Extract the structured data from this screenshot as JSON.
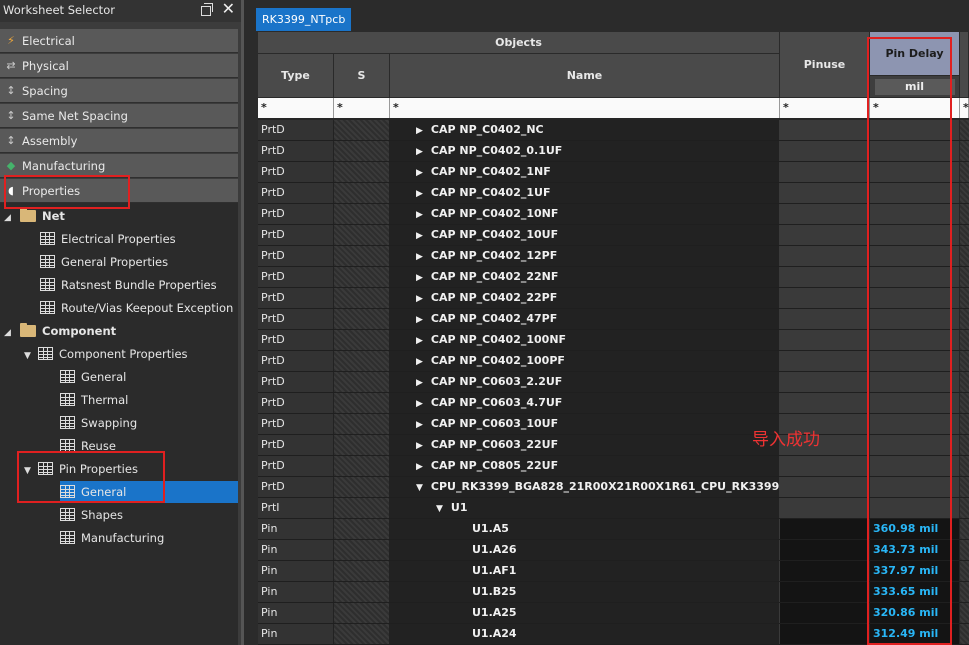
{
  "panel": {
    "title": "Worksheet Selector",
    "categories": [
      {
        "label": "Electrical",
        "icon": "lightning-icon",
        "color": "#f2a93b"
      },
      {
        "label": "Physical",
        "icon": "arrows-icon",
        "color": "#cccccc"
      },
      {
        "label": "Spacing",
        "icon": "spacing-icon",
        "color": "#cccccc"
      },
      {
        "label": "Same Net Spacing",
        "icon": "spacing-icon",
        "color": "#cccccc"
      },
      {
        "label": "Assembly",
        "icon": "spacing-icon",
        "color": "#cccccc"
      },
      {
        "label": "Manufacturing",
        "icon": "layers-icon",
        "color": "#45b36b"
      },
      {
        "label": "Properties",
        "icon": "tag-icon",
        "color": "#ffffff"
      }
    ],
    "tree": {
      "net": "Net",
      "net_items": [
        "Electrical Properties",
        "General Properties",
        "Ratsnest Bundle Properties",
        "Route/Vias Keepout Exception"
      ],
      "component": "Component",
      "component_properties": "Component Properties",
      "component_property_items": [
        "General",
        "Thermal",
        "Swapping",
        "Reuse"
      ],
      "pin_properties": "Pin Properties",
      "pin_property_items": [
        "General",
        "Shapes",
        "Manufacturing"
      ]
    }
  },
  "tab": {
    "label": "RK3399_NTpcb"
  },
  "table": {
    "group_header": "Objects",
    "headers": {
      "type": "Type",
      "s": "S",
      "name": "Name",
      "pinuse": "Pinuse",
      "pin_delay": "Pin Delay",
      "unit": "mil"
    },
    "filter_star": "*",
    "rows": [
      {
        "type": "PrtD",
        "name": "CAP NP_C0402_NC",
        "level": 1,
        "expander": "▶",
        "pd": ""
      },
      {
        "type": "PrtD",
        "name": "CAP NP_C0402_0.1UF",
        "level": 1,
        "expander": "▶",
        "pd": ""
      },
      {
        "type": "PrtD",
        "name": "CAP NP_C0402_1NF",
        "level": 1,
        "expander": "▶",
        "pd": ""
      },
      {
        "type": "PrtD",
        "name": "CAP NP_C0402_1UF",
        "level": 1,
        "expander": "▶",
        "pd": ""
      },
      {
        "type": "PrtD",
        "name": "CAP NP_C0402_10NF",
        "level": 1,
        "expander": "▶",
        "pd": ""
      },
      {
        "type": "PrtD",
        "name": "CAP NP_C0402_10UF",
        "level": 1,
        "expander": "▶",
        "pd": ""
      },
      {
        "type": "PrtD",
        "name": "CAP NP_C0402_12PF",
        "level": 1,
        "expander": "▶",
        "pd": ""
      },
      {
        "type": "PrtD",
        "name": "CAP NP_C0402_22NF",
        "level": 1,
        "expander": "▶",
        "pd": ""
      },
      {
        "type": "PrtD",
        "name": "CAP NP_C0402_22PF",
        "level": 1,
        "expander": "▶",
        "pd": ""
      },
      {
        "type": "PrtD",
        "name": "CAP NP_C0402_47PF",
        "level": 1,
        "expander": "▶",
        "pd": ""
      },
      {
        "type": "PrtD",
        "name": "CAP NP_C0402_100NF",
        "level": 1,
        "expander": "▶",
        "pd": ""
      },
      {
        "type": "PrtD",
        "name": "CAP NP_C0402_100PF",
        "level": 1,
        "expander": "▶",
        "pd": ""
      },
      {
        "type": "PrtD",
        "name": "CAP NP_C0603_2.2UF",
        "level": 1,
        "expander": "▶",
        "pd": ""
      },
      {
        "type": "PrtD",
        "name": "CAP NP_C0603_4.7UF",
        "level": 1,
        "expander": "▶",
        "pd": ""
      },
      {
        "type": "PrtD",
        "name": "CAP NP_C0603_10UF",
        "level": 1,
        "expander": "▶",
        "pd": ""
      },
      {
        "type": "PrtD",
        "name": "CAP NP_C0603_22UF",
        "level": 1,
        "expander": "▶",
        "pd": ""
      },
      {
        "type": "PrtD",
        "name": "CAP NP_C0805_22UF",
        "level": 1,
        "expander": "▶",
        "pd": ""
      },
      {
        "type": "PrtD",
        "name": "CPU_RK3399_BGA828_21R00X21R00X1R61_CPU_RK3399",
        "level": 1,
        "expander": "▼",
        "pd": ""
      },
      {
        "type": "PrtI",
        "name": "U1",
        "level": 2,
        "expander": "▼",
        "pd": ""
      },
      {
        "type": "Pin",
        "name": "U1.A5",
        "level": 3,
        "expander": "",
        "pd": "360.98 mil"
      },
      {
        "type": "Pin",
        "name": "U1.A26",
        "level": 3,
        "expander": "",
        "pd": "343.73 mil"
      },
      {
        "type": "Pin",
        "name": "U1.AF1",
        "level": 3,
        "expander": "",
        "pd": "337.97 mil"
      },
      {
        "type": "Pin",
        "name": "U1.B25",
        "level": 3,
        "expander": "",
        "pd": "333.65 mil"
      },
      {
        "type": "Pin",
        "name": "U1.A25",
        "level": 3,
        "expander": "",
        "pd": "320.86 mil"
      },
      {
        "type": "Pin",
        "name": "U1.A24",
        "level": 3,
        "expander": "",
        "pd": "312.49 mil"
      }
    ]
  },
  "annotation": "导入成功"
}
